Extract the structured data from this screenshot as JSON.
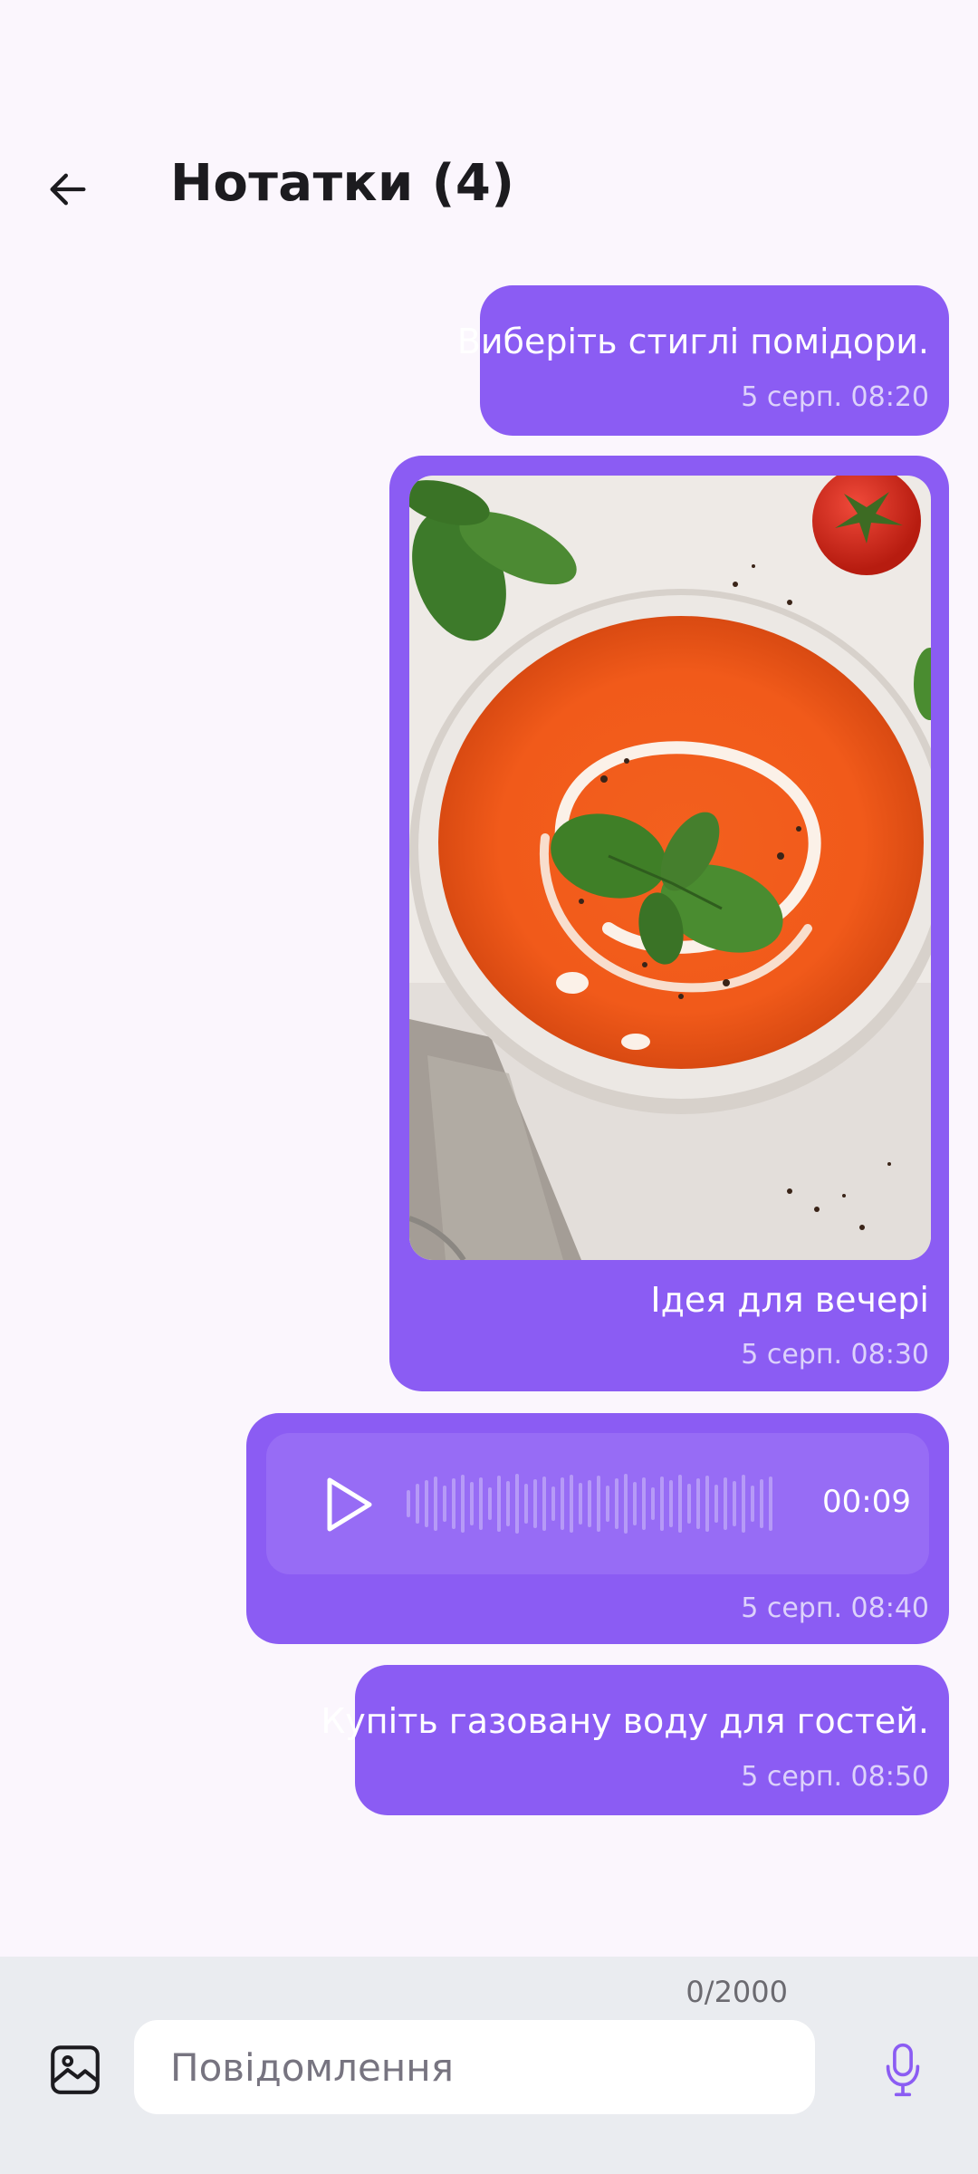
{
  "header": {
    "title": "Нотатки (4)",
    "back_icon": "arrow-left-icon"
  },
  "messages": [
    {
      "type": "text",
      "text": "Виберіть стиглі помідори.",
      "time": "5 серп. 08:20"
    },
    {
      "type": "image",
      "caption": "Ідея для вечері",
      "time": "5 серп. 08:30"
    },
    {
      "type": "audio",
      "duration": "00:09",
      "time": "5 серп. 08:40",
      "play_icon": "play-icon"
    },
    {
      "type": "text",
      "text": "Купіть газовану воду для гостей.",
      "time": "5 серп. 08:50"
    }
  ],
  "composer": {
    "counter": "0/2000",
    "placeholder": "Повідомлення",
    "value": "",
    "gallery_icon": "image-icon",
    "mic_icon": "mic-icon"
  },
  "colors": {
    "bubble": "#8b5cf3",
    "player": "#976cf5",
    "background": "#fbf6fd",
    "composer": "#eaecf0",
    "mic": "#8b5cf3"
  }
}
